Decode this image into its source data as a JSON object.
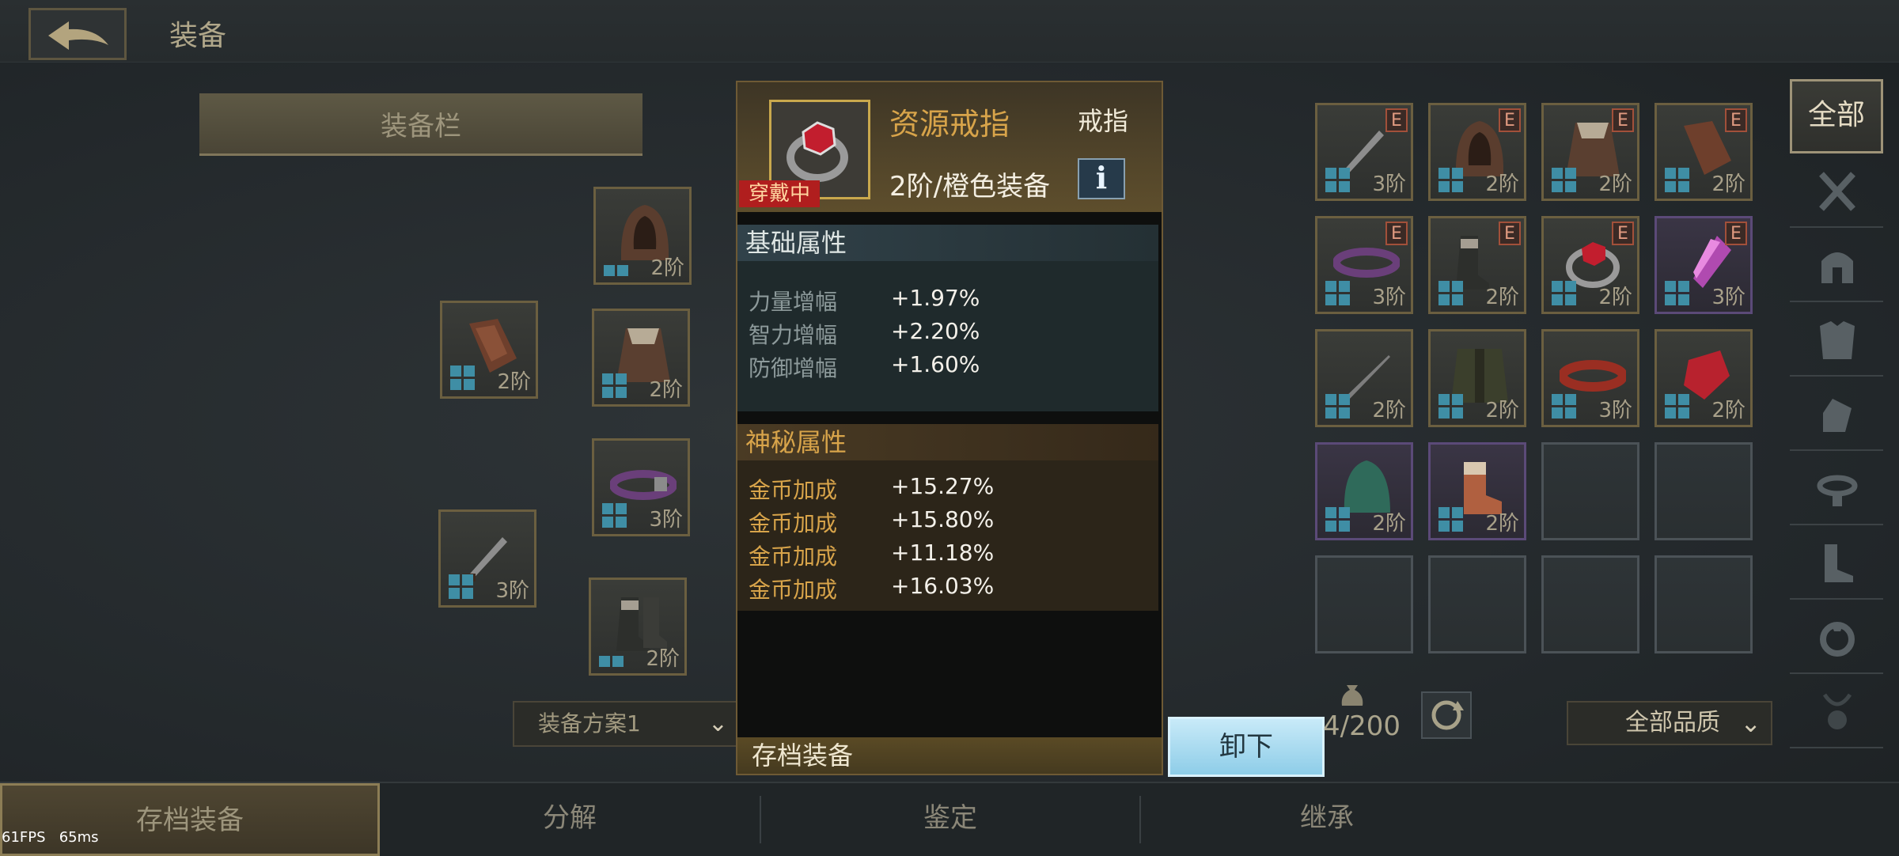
{
  "header": {
    "title": "装备"
  },
  "equipment_panel": {
    "title": "装备栏",
    "slots": [
      {
        "name": "hood",
        "tier": "2阶"
      },
      {
        "name": "bracer",
        "tier": "2阶"
      },
      {
        "name": "cloak",
        "tier": "2阶"
      },
      {
        "name": "belt",
        "tier": "3阶"
      },
      {
        "name": "dagger",
        "tier": "3阶"
      },
      {
        "name": "boots",
        "tier": "2阶"
      }
    ],
    "plan_select": "装备方案1"
  },
  "item_popup": {
    "name": "资源戒指",
    "type": "戒指",
    "grade": "2阶/橙色装备",
    "wearing_tag": "穿戴中",
    "info_icon": "i",
    "base_section": {
      "title": "基础属性",
      "stats": [
        {
          "k": "力量增幅",
          "v": "+1.97%"
        },
        {
          "k": "智力增幅",
          "v": "+2.20%"
        },
        {
          "k": "防御增幅",
          "v": "+1.60%"
        }
      ]
    },
    "mystic_section": {
      "title": "神秘属性",
      "stats": [
        {
          "k": "金币加成",
          "v": "+15.27%"
        },
        {
          "k": "金币加成",
          "v": "+15.80%"
        },
        {
          "k": "金币加成",
          "v": "+11.18%"
        },
        {
          "k": "金币加成",
          "v": "+16.03%"
        }
      ]
    },
    "footer": "存档装备",
    "unequip_button": "卸下"
  },
  "inventory": {
    "grid": [
      {
        "tier": "3阶",
        "badge": "E",
        "rarity": "gold",
        "art": "dagger"
      },
      {
        "tier": "2阶",
        "badge": "E",
        "rarity": "gold",
        "art": "hood"
      },
      {
        "tier": "2阶",
        "badge": "E",
        "rarity": "gold",
        "art": "cloak"
      },
      {
        "tier": "2阶",
        "badge": "E",
        "rarity": "gold",
        "art": "bracer"
      },
      {
        "tier": "3阶",
        "badge": "E",
        "rarity": "gold",
        "art": "belt"
      },
      {
        "tier": "2阶",
        "badge": "E",
        "rarity": "gold",
        "art": "boots"
      },
      {
        "tier": "2阶",
        "badge": "E",
        "rarity": "gold",
        "art": "ring"
      },
      {
        "tier": "3阶",
        "badge": "E",
        "rarity": "purple",
        "art": "crystal"
      },
      {
        "tier": "2阶",
        "badge": "",
        "rarity": "gold",
        "art": "needle"
      },
      {
        "tier": "2阶",
        "badge": "",
        "rarity": "gold",
        "art": "coat"
      },
      {
        "tier": "3阶",
        "badge": "",
        "rarity": "gold",
        "art": "redbelt"
      },
      {
        "tier": "2阶",
        "badge": "",
        "rarity": "gold",
        "art": "gem"
      },
      {
        "tier": "2阶",
        "badge": "",
        "rarity": "purple",
        "art": "greenhood"
      },
      {
        "tier": "2阶",
        "badge": "",
        "rarity": "purple",
        "art": "redboot"
      }
    ],
    "bag_count": "4/200",
    "quality_filter": "全部品质"
  },
  "categories": {
    "all": "全部"
  },
  "bottom_tabs": [
    "存档装备",
    "分解",
    "鉴定",
    "继承"
  ],
  "fps": {
    "fps": "61FPS",
    "ms": "65ms"
  },
  "colors": {
    "gold_border": "#6b5f40",
    "purple_border": "#5b4a78",
    "accent": "#d8a44a"
  }
}
